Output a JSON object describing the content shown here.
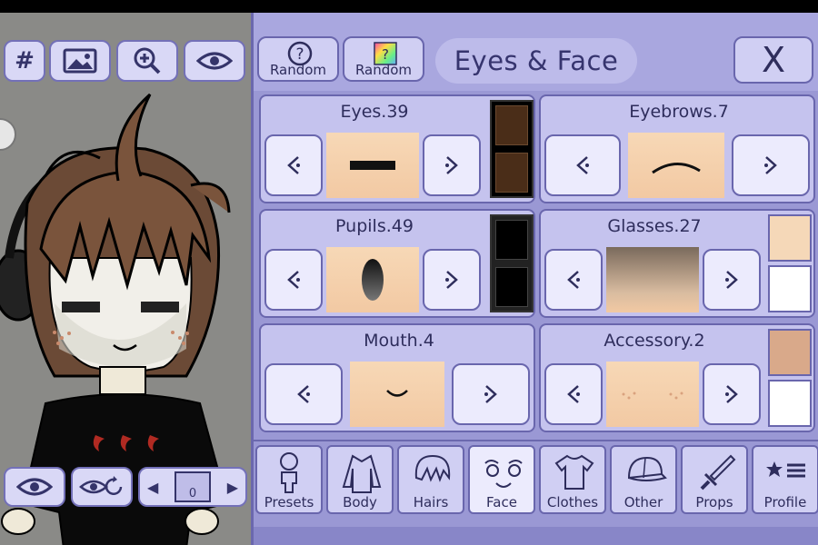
{
  "panel": {
    "title": "Eyes & Face",
    "random_buttons": [
      {
        "label": "Random",
        "icon": "question-icon"
      },
      {
        "label": "Random",
        "icon": "random-color-icon"
      }
    ],
    "close_label": "X"
  },
  "categories": {
    "eyes": {
      "title": "Eyes.39"
    },
    "eyebrows": {
      "title": "Eyebrows.7"
    },
    "pupils": {
      "title": "Pupils.49"
    },
    "glasses": {
      "title": "Glasses.27"
    },
    "mouth": {
      "title": "Mouth.4"
    },
    "accessory": {
      "title": "Accessory.2"
    }
  },
  "tabs": [
    {
      "label": "Presets",
      "icon": "presets-icon"
    },
    {
      "label": "Body",
      "icon": "body-icon"
    },
    {
      "label": "Hairs",
      "icon": "hair-icon"
    },
    {
      "label": "Face",
      "icon": "face-icon",
      "active": true
    },
    {
      "label": "Clothes",
      "icon": "shirt-icon"
    },
    {
      "label": "Other",
      "icon": "cap-icon"
    },
    {
      "label": "Props",
      "icon": "sword-icon"
    },
    {
      "label": "Profile",
      "icon": "profile-list-icon"
    }
  ],
  "toolbar": {
    "hash_label": "#",
    "icons": [
      "hash-icon",
      "image-icon",
      "zoom-in-icon",
      "eye-icon"
    ]
  },
  "bottom_controls": {
    "layer_value": "0"
  },
  "colors": {
    "panel": "#9a98d4",
    "button": "#d0cff3",
    "accent": "#6966ad",
    "skin": "#f7d8b6"
  }
}
